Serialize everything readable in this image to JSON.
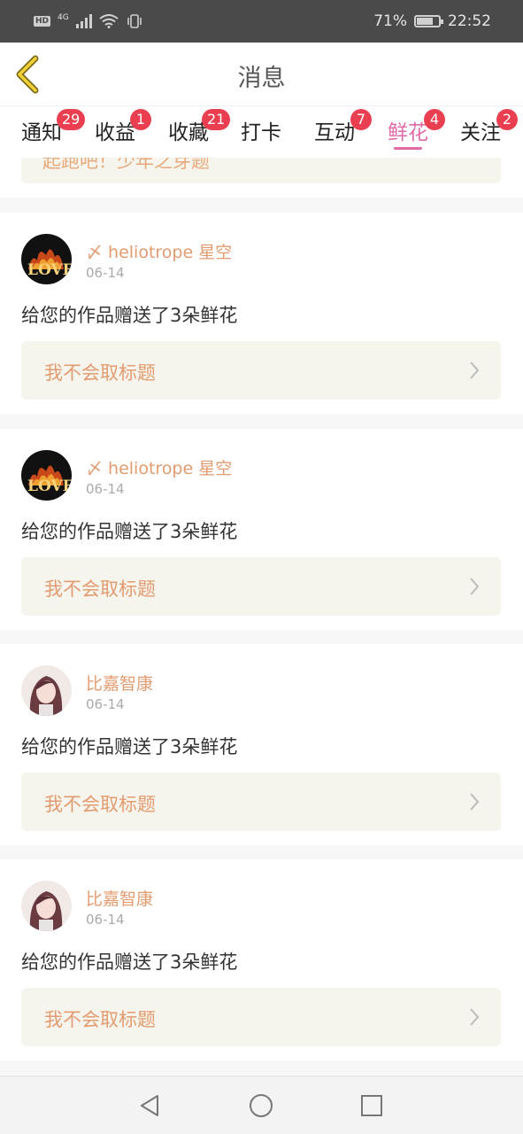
{
  "status": {
    "left_badge": "HD",
    "network": "4G",
    "battery_pct": "71%",
    "battery_level": 0.71,
    "time": "22:52"
  },
  "header": {
    "title": "消息",
    "back_icon": "chevron-left-icon"
  },
  "tabs": [
    {
      "label": "通知",
      "badge": "29"
    },
    {
      "label": "收益",
      "badge": "1"
    },
    {
      "label": "收藏",
      "badge": "21"
    },
    {
      "label": "打卡",
      "badge": ""
    },
    {
      "label": "互动",
      "badge": "7"
    },
    {
      "label": "鲜花",
      "badge": "4"
    },
    {
      "label": "关注",
      "badge": "2"
    }
  ],
  "partial_card": {
    "work_title": "起跑吧！少年之芽题"
  },
  "messages": [
    {
      "user": "〆 heliotrope 星空",
      "date": "06-14",
      "text": "给您的作品赠送了3朵鲜花",
      "work_title": "我不会取标题"
    },
    {
      "user": "〆 heliotrope 星空",
      "date": "06-14",
      "text": "给您的作品赠送了3朵鲜花",
      "work_title": "我不会取标题"
    },
    {
      "user": "比嘉智康",
      "date": "06-14",
      "text": "给您的作品赠送了3朵鲜花",
      "work_title": "我不会取标题"
    },
    {
      "user": "比嘉智康",
      "date": "06-14",
      "text": "给您的作品赠送了3朵鲜花",
      "work_title": "我不会取标题"
    }
  ],
  "colors": {
    "accent": "#e06aa8",
    "badge": "#ea3f50",
    "username": "#e39b6f"
  },
  "nav": {
    "back": "triangle-back-icon",
    "home": "circle-home-icon",
    "recent": "square-recents-icon"
  }
}
